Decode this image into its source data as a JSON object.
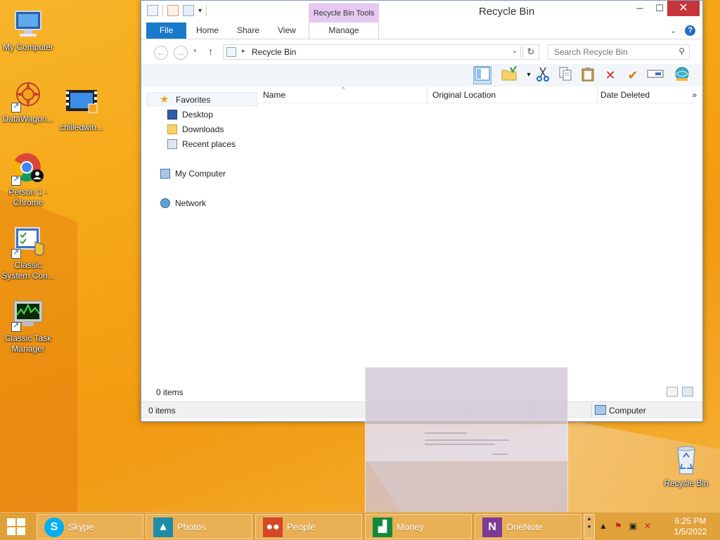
{
  "desktop": {
    "icons": [
      {
        "label": "My Computer"
      },
      {
        "label": "DataWagon..."
      },
      {
        "label": "chilledwin..."
      },
      {
        "label": "Person 1 - Chrome"
      },
      {
        "label": "Classic System Con..."
      },
      {
        "label": "Classic Task Manager"
      },
      {
        "label": "Recycle Bin"
      }
    ]
  },
  "window": {
    "title": "Recycle Bin",
    "context_tab": "Recycle Bin Tools",
    "buttons": {
      "minimize": "─",
      "maximize": "☐",
      "close": "✕"
    },
    "tabs": {
      "file": "File",
      "home": "Home",
      "share": "Share",
      "view": "View",
      "manage": "Manage"
    },
    "address": {
      "path": "Recycle Bin",
      "refresh": "↻"
    },
    "search": {
      "placeholder": "Search Recycle Bin"
    },
    "nav": {
      "favorites": "Favorites",
      "desktop": "Desktop",
      "downloads": "Downloads",
      "recent": "Recent places",
      "my_computer": "My Computer",
      "network": "Network"
    },
    "columns": {
      "name": "Name",
      "location": "Original Location",
      "deleted": "Date Deleted",
      "more": "»"
    },
    "status_inner": "0 items",
    "status_outer": {
      "count": "0 items",
      "location": "Computer"
    }
  },
  "taskbar": {
    "apps": [
      {
        "label": "Skype",
        "color": "#00aff0"
      },
      {
        "label": "Photos",
        "color": "#1e8ca8"
      },
      {
        "label": "People",
        "color": "#d24726"
      },
      {
        "label": "Money",
        "color": "#128a3e"
      },
      {
        "label": "OneNote",
        "color": "#7b3a96"
      }
    ],
    "clock": {
      "time": "6:25 PM",
      "date": "1/5/2022"
    }
  }
}
